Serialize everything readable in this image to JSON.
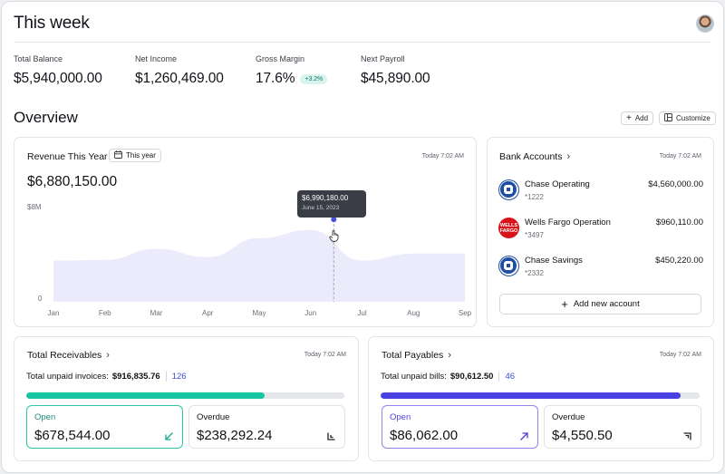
{
  "header": {
    "title": "This week"
  },
  "stats": [
    {
      "label": "Total Balance",
      "value": "$5,940,000.00"
    },
    {
      "label": "Net Income",
      "value": "$1,260,469.00"
    },
    {
      "label": "Gross Margin",
      "value": "17.6%",
      "badge": "+3.2%"
    },
    {
      "label": "Next Payroll",
      "value": "$45,890.00"
    }
  ],
  "overview": {
    "title": "Overview",
    "add_label": "Add",
    "customize_label": "Customize"
  },
  "revenue": {
    "title": "Revenue This Year",
    "period": "This year",
    "timestamp": "Today 7:02 AM",
    "total": "$6,880,150.00",
    "tooltip_value": "$6,990,180.00",
    "tooltip_date": "June 15, 2023"
  },
  "chart_data": {
    "type": "area",
    "categories": [
      "Jan",
      "Feb",
      "Mar",
      "Apr",
      "May",
      "Jun",
      "Jul",
      "Aug",
      "Sep"
    ],
    "values": [
      3.5,
      3.55,
      4.5,
      3.8,
      5.4,
      6.1,
      3.5,
      4.1,
      4.1
    ],
    "ytick_labels": [
      "$8M",
      "0"
    ],
    "ylim": [
      0,
      8
    ],
    "highlight": {
      "category": "Jun",
      "value": 6.99
    },
    "fill_color": "#ecebfc",
    "point_color": "#4a4fe0"
  },
  "banks": {
    "title": "Bank Accounts",
    "timestamp": "Today 7:02 AM",
    "accounts": [
      {
        "name": "Chase Operating",
        "number": "*1222",
        "amount": "$4,560,000.00",
        "icon": "chase-logo"
      },
      {
        "name": "Wells Fargo Operation",
        "number": "*3497",
        "amount": "$960,110.00",
        "icon": "wells-fargo-logo",
        "logo_text_1": "WELLS",
        "logo_text_2": "FARGO"
      },
      {
        "name": "Chase Savings",
        "number": "*2332",
        "amount": "$450,220.00",
        "icon": "chase-logo"
      }
    ],
    "add_label": "Add new account"
  },
  "receivables": {
    "title": "Total Receivables",
    "timestamp": "Today 7:02 AM",
    "summary_label": "Total unpaid invoices:",
    "summary_amount": "$916,835.76",
    "summary_count": "126",
    "progress": 0.75,
    "bar_color": "#19c4a2",
    "open_label": "Open",
    "open_value": "$678,544.00",
    "overdue_label": "Overdue",
    "overdue_value": "$238,292.24"
  },
  "payables": {
    "title": "Total Payables",
    "timestamp": "Today 7:02 AM",
    "summary_label": "Total unpaid bills:",
    "summary_amount": "$90,612.50",
    "summary_count": "46",
    "progress": 0.94,
    "bar_color": "#4a3fe0",
    "open_label": "Open",
    "open_value": "$86,062.00",
    "overdue_label": "Overdue",
    "overdue_value": "$4,550.50"
  }
}
